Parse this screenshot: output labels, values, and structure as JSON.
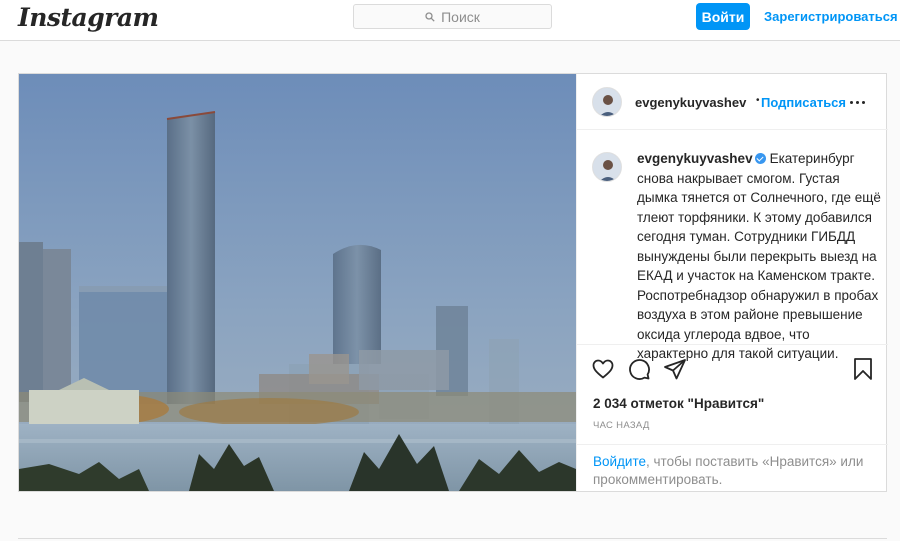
{
  "header": {
    "logo": "Instagram",
    "search_placeholder": "Поиск",
    "login_label": "Войти",
    "signup_label": "Зарегистрироваться"
  },
  "post": {
    "username": "evgenykuyvashev",
    "separator": "•",
    "follow_label": "Подписаться",
    "verified": true,
    "caption_user": "evgenykuyvashev",
    "caption_text": "Екатеринбург снова накрывает смогом. Густая дымка тянется от Солнечного, где ещё тлеют торфяники. К этому добавился сегодня туман. Сотрудники ГИБДД вынуждены были перекрыть выезд на ЕКАД и участок на Каменском тракте. Роспотребнадзор обнаружил в пробах воздуха в этом районе превышение оксида углерода вдвое, что характерно для такой ситуации.",
    "likes_text": "2 034 отметок \"Нравится\"",
    "timestamp": "ЧАС НАЗАД",
    "login_prompt_link": "Войдите",
    "login_prompt_text": ", чтобы поставить «Нравится» или прокомментировать."
  },
  "icons": {
    "like": "heart-icon",
    "comment": "comment-icon",
    "share": "share-icon",
    "save": "bookmark-icon",
    "more": "more-options-icon",
    "search": "search-icon",
    "verified": "verified-badge-icon"
  },
  "colors": {
    "accent": "#0095f6",
    "border": "#dbdbdb",
    "background": "#fafafa",
    "text": "#262626",
    "muted": "#8e8e8e",
    "verified": "#3897f0"
  }
}
